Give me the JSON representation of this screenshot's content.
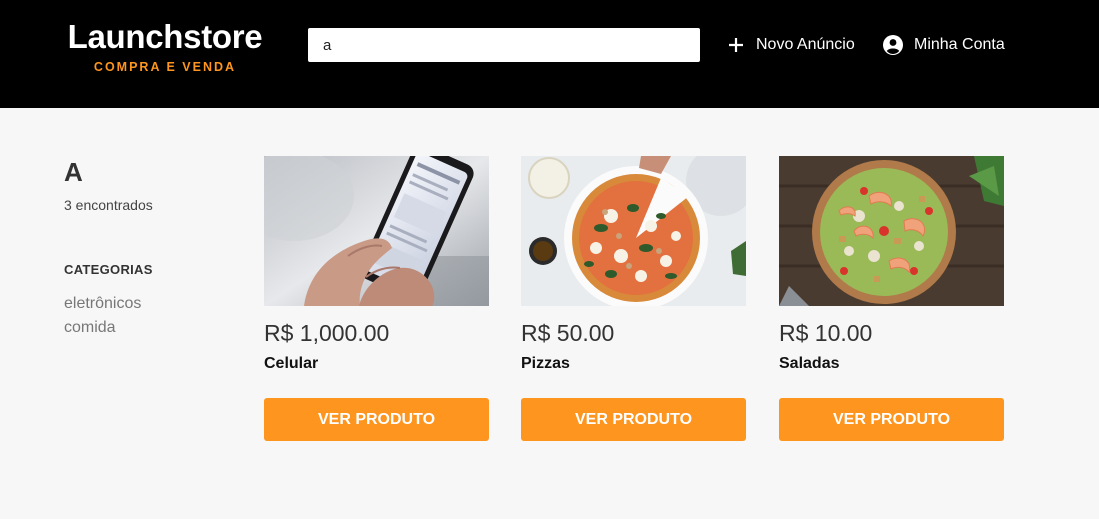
{
  "header": {
    "logo_title": "Launchstore",
    "logo_subtitle": "COMPRA E VENDA",
    "search_value": "a",
    "new_listing_label": "Novo Anúncio",
    "account_label": "Minha Conta"
  },
  "sidebar": {
    "search_term": "A",
    "found_text": "3 encontrados",
    "categories_title": "CATEGORIAS",
    "categories": [
      "eletrônicos",
      "comida"
    ]
  },
  "products": [
    {
      "price": "R$ 1,000.00",
      "name": "Celular",
      "button": "VER PRODUTO",
      "image": "phone-photo"
    },
    {
      "price": "R$ 50.00",
      "name": "Pizzas",
      "button": "VER PRODUTO",
      "image": "pizza-photo"
    },
    {
      "price": "R$ 10.00",
      "name": "Saladas",
      "button": "VER PRODUTO",
      "image": "salad-photo"
    }
  ],
  "colors": {
    "accent": "#fd951f",
    "header_bg": "#000000",
    "page_bg": "#f7f7f7"
  }
}
